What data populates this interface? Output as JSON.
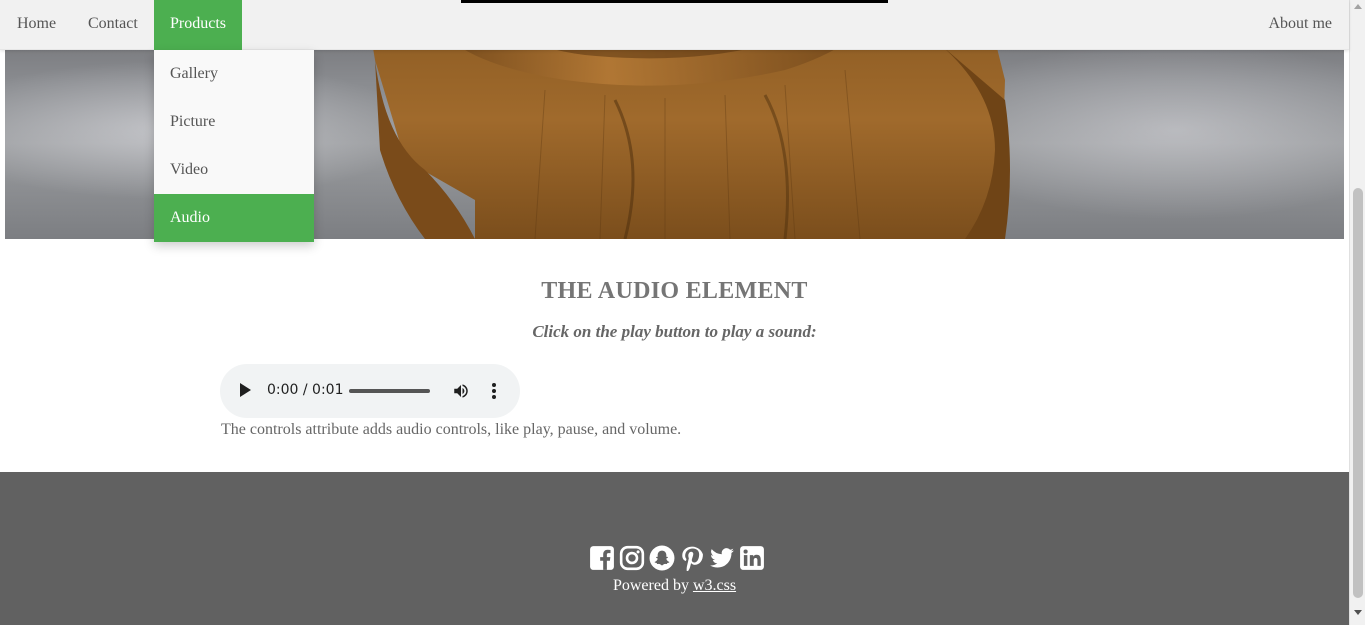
{
  "navbar": {
    "items": [
      {
        "label": "Home"
      },
      {
        "label": "Contact"
      },
      {
        "label": "Products",
        "active": true
      },
      {
        "label": "About me"
      }
    ]
  },
  "dropdown": {
    "items": [
      {
        "label": "Gallery"
      },
      {
        "label": "Picture"
      },
      {
        "label": "Video"
      },
      {
        "label": "Audio",
        "active": true
      }
    ]
  },
  "content": {
    "title": "THE AUDIO ELEMENT",
    "subtitle": "Click on the play button to play a sound:",
    "audio": {
      "time": "0:00 / 0:01",
      "progress": 0
    },
    "note": "The controls attribute adds audio controls, like play, pause, and volume."
  },
  "footer": {
    "social_icons": [
      "facebook-icon",
      "instagram-icon",
      "snapchat-icon",
      "pinterest-icon",
      "twitter-icon",
      "linkedin-icon"
    ],
    "powered_prefix": "Powered by",
    "powered_link": "w3.css"
  },
  "colors": {
    "accent": "#4caf50",
    "navbar_bg": "#f1f1f1",
    "footer_bg": "#616161"
  }
}
